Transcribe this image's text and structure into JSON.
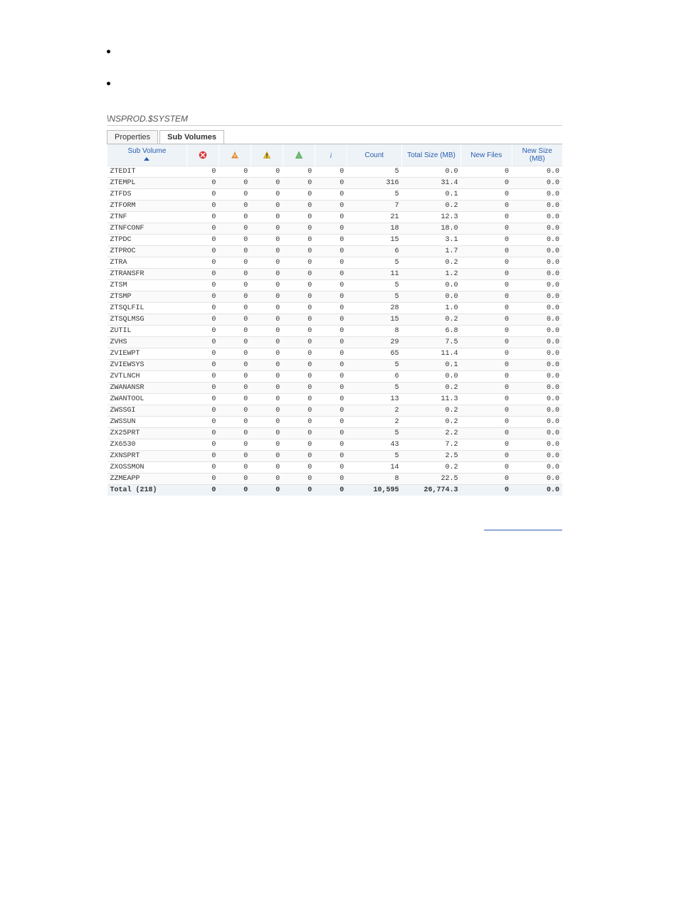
{
  "breadcrumb": "\\NSPROD.$SYSTEM",
  "tabs": {
    "properties": "Properties",
    "subvolumes": "Sub Volumes"
  },
  "headers": {
    "subvol": "Sub Volume",
    "count": "Count",
    "totalsize": "Total Size (MB)",
    "newfiles": "New Files",
    "newsize": "New Size (MB)"
  },
  "rows": [
    {
      "n": "ZTEDIT",
      "c1": 0,
      "c2": 0,
      "c3": 0,
      "c4": 0,
      "c5": 0,
      "count": "5",
      "ts": "0.0",
      "nf": 0,
      "ns": "0.0"
    },
    {
      "n": "ZTEMPL",
      "c1": 0,
      "c2": 0,
      "c3": 0,
      "c4": 0,
      "c5": 0,
      "count": "316",
      "ts": "31.4",
      "nf": 0,
      "ns": "0.0"
    },
    {
      "n": "ZTFDS",
      "c1": 0,
      "c2": 0,
      "c3": 0,
      "c4": 0,
      "c5": 0,
      "count": "5",
      "ts": "0.1",
      "nf": 0,
      "ns": "0.0"
    },
    {
      "n": "ZTFORM",
      "c1": 0,
      "c2": 0,
      "c3": 0,
      "c4": 0,
      "c5": 0,
      "count": "7",
      "ts": "0.2",
      "nf": 0,
      "ns": "0.0"
    },
    {
      "n": "ZTNF",
      "c1": 0,
      "c2": 0,
      "c3": 0,
      "c4": 0,
      "c5": 0,
      "count": "21",
      "ts": "12.3",
      "nf": 0,
      "ns": "0.0"
    },
    {
      "n": "ZTNFCONF",
      "c1": 0,
      "c2": 0,
      "c3": 0,
      "c4": 0,
      "c5": 0,
      "count": "18",
      "ts": "18.0",
      "nf": 0,
      "ns": "0.0"
    },
    {
      "n": "ZTPDC",
      "c1": 0,
      "c2": 0,
      "c3": 0,
      "c4": 0,
      "c5": 0,
      "count": "15",
      "ts": "3.1",
      "nf": 0,
      "ns": "0.0"
    },
    {
      "n": "ZTPROC",
      "c1": 0,
      "c2": 0,
      "c3": 0,
      "c4": 0,
      "c5": 0,
      "count": "6",
      "ts": "1.7",
      "nf": 0,
      "ns": "0.0"
    },
    {
      "n": "ZTRA",
      "c1": 0,
      "c2": 0,
      "c3": 0,
      "c4": 0,
      "c5": 0,
      "count": "5",
      "ts": "0.2",
      "nf": 0,
      "ns": "0.0"
    },
    {
      "n": "ZTRANSFR",
      "c1": 0,
      "c2": 0,
      "c3": 0,
      "c4": 0,
      "c5": 0,
      "count": "11",
      "ts": "1.2",
      "nf": 0,
      "ns": "0.0"
    },
    {
      "n": "ZTSM",
      "c1": 0,
      "c2": 0,
      "c3": 0,
      "c4": 0,
      "c5": 0,
      "count": "5",
      "ts": "0.0",
      "nf": 0,
      "ns": "0.0"
    },
    {
      "n": "ZTSMP",
      "c1": 0,
      "c2": 0,
      "c3": 0,
      "c4": 0,
      "c5": 0,
      "count": "5",
      "ts": "0.0",
      "nf": 0,
      "ns": "0.0"
    },
    {
      "n": "ZTSQLFIL",
      "c1": 0,
      "c2": 0,
      "c3": 0,
      "c4": 0,
      "c5": 0,
      "count": "28",
      "ts": "1.0",
      "nf": 0,
      "ns": "0.0"
    },
    {
      "n": "ZTSQLMSG",
      "c1": 0,
      "c2": 0,
      "c3": 0,
      "c4": 0,
      "c5": 0,
      "count": "15",
      "ts": "0.2",
      "nf": 0,
      "ns": "0.0"
    },
    {
      "n": "ZUTIL",
      "c1": 0,
      "c2": 0,
      "c3": 0,
      "c4": 0,
      "c5": 0,
      "count": "8",
      "ts": "6.8",
      "nf": 0,
      "ns": "0.0"
    },
    {
      "n": "ZVHS",
      "c1": 0,
      "c2": 0,
      "c3": 0,
      "c4": 0,
      "c5": 0,
      "count": "29",
      "ts": "7.5",
      "nf": 0,
      "ns": "0.0"
    },
    {
      "n": "ZVIEWPT",
      "c1": 0,
      "c2": 0,
      "c3": 0,
      "c4": 0,
      "c5": 0,
      "count": "65",
      "ts": "11.4",
      "nf": 0,
      "ns": "0.0"
    },
    {
      "n": "ZVIEWSYS",
      "c1": 0,
      "c2": 0,
      "c3": 0,
      "c4": 0,
      "c5": 0,
      "count": "5",
      "ts": "0.1",
      "nf": 0,
      "ns": "0.0"
    },
    {
      "n": "ZVTLNCH",
      "c1": 0,
      "c2": 0,
      "c3": 0,
      "c4": 0,
      "c5": 0,
      "count": "6",
      "ts": "0.0",
      "nf": 0,
      "ns": "0.0"
    },
    {
      "n": "ZWANANSR",
      "c1": 0,
      "c2": 0,
      "c3": 0,
      "c4": 0,
      "c5": 0,
      "count": "5",
      "ts": "0.2",
      "nf": 0,
      "ns": "0.0"
    },
    {
      "n": "ZWANTOOL",
      "c1": 0,
      "c2": 0,
      "c3": 0,
      "c4": 0,
      "c5": 0,
      "count": "13",
      "ts": "11.3",
      "nf": 0,
      "ns": "0.0"
    },
    {
      "n": "ZWSSGI",
      "c1": 0,
      "c2": 0,
      "c3": 0,
      "c4": 0,
      "c5": 0,
      "count": "2",
      "ts": "0.2",
      "nf": 0,
      "ns": "0.0"
    },
    {
      "n": "ZWSSUN",
      "c1": 0,
      "c2": 0,
      "c3": 0,
      "c4": 0,
      "c5": 0,
      "count": "2",
      "ts": "0.2",
      "nf": 0,
      "ns": "0.0"
    },
    {
      "n": "ZX25PRT",
      "c1": 0,
      "c2": 0,
      "c3": 0,
      "c4": 0,
      "c5": 0,
      "count": "5",
      "ts": "2.2",
      "nf": 0,
      "ns": "0.0"
    },
    {
      "n": "ZX6530",
      "c1": 0,
      "c2": 0,
      "c3": 0,
      "c4": 0,
      "c5": 0,
      "count": "43",
      "ts": "7.2",
      "nf": 0,
      "ns": "0.0"
    },
    {
      "n": "ZXNSPRT",
      "c1": 0,
      "c2": 0,
      "c3": 0,
      "c4": 0,
      "c5": 0,
      "count": "5",
      "ts": "2.5",
      "nf": 0,
      "ns": "0.0"
    },
    {
      "n": "ZXOSSMON",
      "c1": 0,
      "c2": 0,
      "c3": 0,
      "c4": 0,
      "c5": 0,
      "count": "14",
      "ts": "0.2",
      "nf": 0,
      "ns": "0.0"
    },
    {
      "n": "ZZMEAPP",
      "c1": 0,
      "c2": 0,
      "c3": 0,
      "c4": 0,
      "c5": 0,
      "count": "8",
      "ts": "22.5",
      "nf": 0,
      "ns": "0.0"
    },
    {
      "n": "Total (218)",
      "c1": 0,
      "c2": 0,
      "c3": 0,
      "c4": 0,
      "c5": 0,
      "count": "10,595",
      "ts": "26,774.3",
      "nf": 0,
      "ns": "0.0"
    }
  ]
}
